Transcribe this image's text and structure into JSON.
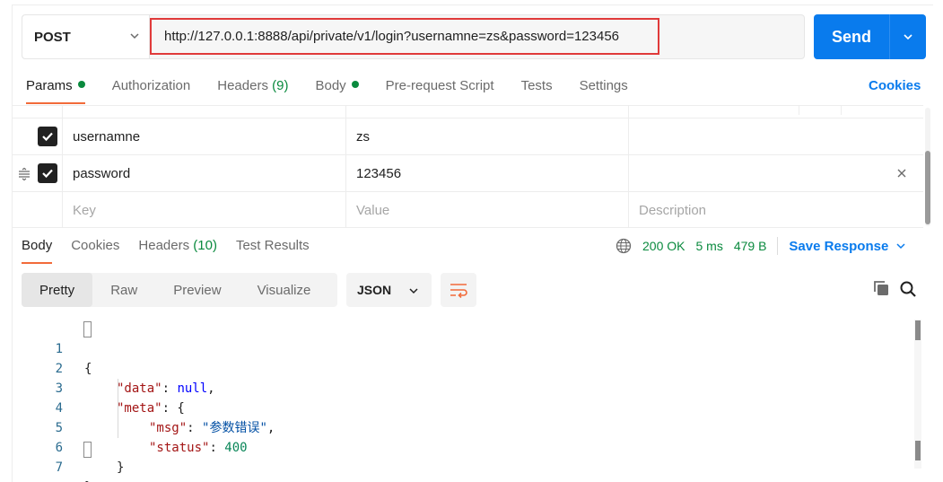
{
  "request": {
    "method": "POST",
    "url": "http://127.0.0.1:8888/api/private/v1/login?usernamne=zs&password=123456",
    "send_label": "Send"
  },
  "request_tabs": [
    {
      "label": "Params",
      "active": true,
      "dot": true
    },
    {
      "label": "Authorization"
    },
    {
      "label": "Headers",
      "count": "(9)"
    },
    {
      "label": "Body",
      "dot": true
    },
    {
      "label": "Pre-request Script"
    },
    {
      "label": "Tests"
    },
    {
      "label": "Settings"
    }
  ],
  "cookies_label": "Cookies",
  "params": {
    "rows": [
      {
        "checked": true,
        "key": "usernamne",
        "value": "zs",
        "description": ""
      },
      {
        "checked": true,
        "key": "password",
        "value": "123456",
        "description": ""
      }
    ],
    "placeholder": {
      "key": "Key",
      "value": "Value",
      "description": "Description"
    }
  },
  "response_tabs": [
    {
      "label": "Body",
      "active": true
    },
    {
      "label": "Cookies"
    },
    {
      "label": "Headers",
      "count": "(10)"
    },
    {
      "label": "Test Results"
    }
  ],
  "response_status": {
    "status": "200 OK",
    "time": "5 ms",
    "size": "479 B",
    "save_label": "Save Response"
  },
  "body_toolbar": {
    "views": [
      "Pretty",
      "Raw",
      "Preview",
      "Visualize"
    ],
    "active_view": "Pretty",
    "format": "JSON"
  },
  "code": {
    "line_numbers": [
      "1",
      "2",
      "3",
      "4",
      "5",
      "6",
      "7"
    ],
    "tokens": {
      "open_brace": "{",
      "data_key": "\"data\"",
      "data_val": "null",
      "meta_key": "\"meta\"",
      "msg_key": "\"msg\"",
      "msg_val": "\"参数错误\"",
      "status_key": "\"status\"",
      "status_val": "400",
      "close_inner": "}",
      "close_brace": "}"
    }
  },
  "colors": {
    "accent": "#097bed",
    "tab_indicator": "#f26b3a",
    "success": "#0a8a3e",
    "url_highlight": "#e03a3a"
  }
}
